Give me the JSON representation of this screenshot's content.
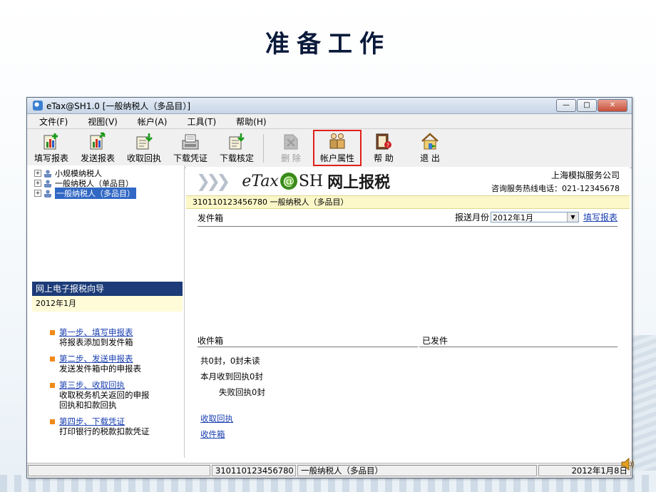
{
  "slide": {
    "title": "准备工作"
  },
  "window": {
    "title": "eTax@SH1.0 [一般纳税人（多品目）]",
    "controls": {
      "minimize": "—",
      "maximize": "□",
      "close": "✕"
    }
  },
  "menu": [
    "文件(F)",
    "视图(V)",
    "帐户(A)",
    "工具(T)",
    "帮助(H)"
  ],
  "toolbar": [
    {
      "label": "填写报表",
      "icon": "fill-report-icon"
    },
    {
      "label": "发送报表",
      "icon": "send-report-icon"
    },
    {
      "label": "收取回执",
      "icon": "receive-receipt-icon"
    },
    {
      "label": "下载凭证",
      "icon": "download-voucher-icon"
    },
    {
      "label": "下载核定",
      "icon": "download-approval-icon"
    },
    {
      "label": "删  除",
      "icon": "delete-icon",
      "disabled": true
    },
    {
      "label": "帐户属性",
      "icon": "account-properties-icon",
      "highlighted": true
    },
    {
      "label": "帮  助",
      "icon": "help-icon"
    },
    {
      "label": "退  出",
      "icon": "exit-icon"
    }
  ],
  "tree": [
    {
      "label": "小规模纳税人",
      "selected": false
    },
    {
      "label": "一般纳税人（单品目）",
      "selected": false
    },
    {
      "label": "一般纳税人（多品目）",
      "selected": true
    }
  ],
  "guide": {
    "title": "网上电子报税向导",
    "date": "2012年1月",
    "steps": [
      {
        "link": "第一步、填写申报表",
        "desc": "将报表添加到发件箱"
      },
      {
        "link": "第二步、发送申报表",
        "desc": "发送发件箱中的申报表"
      },
      {
        "link": "第三步、收取回执",
        "desc": "收取税务机关返回的申报回执和扣款回执"
      },
      {
        "link": "第四步、下载凭证",
        "desc": "打印银行的税款扣款凭证"
      }
    ]
  },
  "banner": {
    "brand_pre": "eTax",
    "brand_at": "@",
    "brand_post": "SH",
    "brand_cn": "网上报税",
    "company": "上海模拟服务公司",
    "hotline": "咨询服务热线电话：021-12345678"
  },
  "account_bar": "310110123456780  一般纳税人（多品目）",
  "outbox": {
    "title": "发件箱",
    "month_label": "报送月份",
    "month_value": "2012年1月",
    "fill_link": "填写报表"
  },
  "inbox": {
    "title": "收件箱",
    "count_text": "共0封，0封未读",
    "receipt_text": "本月收到回执0封",
    "failed_text": "失败回执0封",
    "link_receive": "收取回执",
    "link_inbox": "收件箱"
  },
  "sent": {
    "title": "已发件"
  },
  "statusbar": {
    "tax_id": "310110123456780",
    "account": "一般纳税人（多品目）",
    "date": "2012年1月8日"
  },
  "colors": {
    "highlight_border": "#e0201a",
    "guide_header": "#1c3b78",
    "info_bar": "#fbf7c8",
    "link": "#1a3fb0"
  }
}
